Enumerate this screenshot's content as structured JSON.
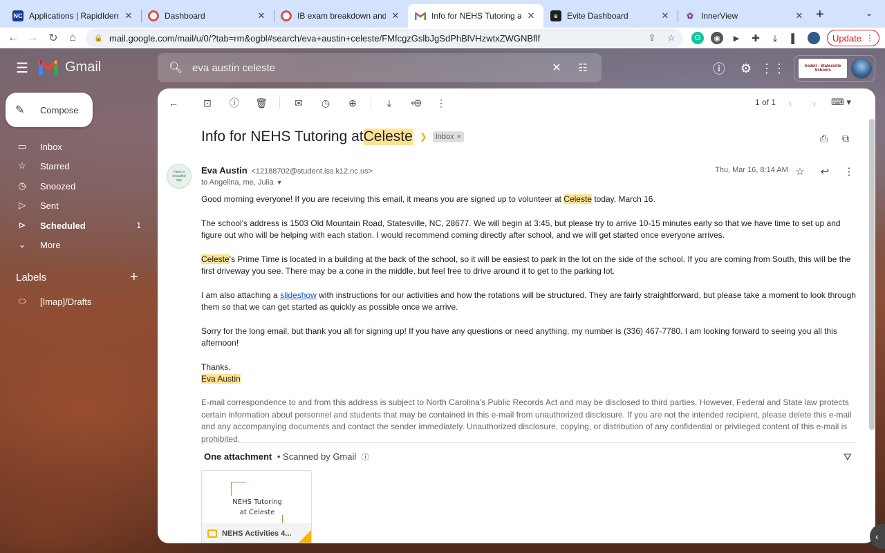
{
  "browser": {
    "tabs": [
      {
        "title": "Applications | RapidIdentity",
        "favicon": "nc-icon"
      },
      {
        "title": "Dashboard",
        "favicon": "lifesaver-icon"
      },
      {
        "title": "IB exam breakdown and stu",
        "favicon": "lifesaver-icon"
      },
      {
        "title": "Info for NEHS Tutoring at C",
        "favicon": "gmail-icon"
      },
      {
        "title": "Evite Dashboard",
        "favicon": "evite-icon"
      },
      {
        "title": "InnerView",
        "favicon": "innerview-icon"
      }
    ],
    "url": "mail.google.com/mail/u/0/?tab=rm&ogbl#search/eva+austin+celeste/FMfcgzGslbJgSdPhBlVHzwtxZWGNBflf",
    "update_label": "Update"
  },
  "gmail": {
    "logo_text": "Gmail",
    "search_value": "eva austin celeste",
    "org_logo_text": "Iredell - Statesville Schools",
    "compose_label": "Compose",
    "nav": [
      {
        "label": "Inbox",
        "icon": "inbox-icon",
        "count": ""
      },
      {
        "label": "Starred",
        "icon": "star-icon",
        "count": ""
      },
      {
        "label": "Snoozed",
        "icon": "clock-icon",
        "count": ""
      },
      {
        "label": "Sent",
        "icon": "send-icon",
        "count": ""
      },
      {
        "label": "Scheduled",
        "icon": "scheduled-icon",
        "count": "1"
      },
      {
        "label": "More",
        "icon": "chevron-down-icon",
        "count": ""
      }
    ],
    "labels_heading": "Labels",
    "labels": [
      {
        "label": "[Imap]/Drafts"
      }
    ],
    "pager": "1 of 1"
  },
  "email": {
    "subject_prefix": "Info for NEHS Tutoring at ",
    "subject_highlight": "Celeste",
    "inbox_chip": "Inbox",
    "sender_name": "Eva Austin",
    "sender_email": "<12188702@student.iss.k12.nc.us>",
    "to_line": "to Angelina, me, Julia",
    "date": "Thu, Mar 16, 8:14 AM",
    "p1_a": "Good morning everyone! If you are receiving this email, it means you are signed up to volunteer at ",
    "p1_hl": "Celeste",
    "p1_b": " today, March 16.",
    "p2": "The school's address is 1503 Old Mountain Road, Statesville, NC, 28677. We will begin at 3:45, but please try to arrive 10-15 minutes early so that we have time to set up and figure out who will be helping with each station. I would recommend coming directly after school, and we will get started once everyone arrives.",
    "p3_hl": "Celeste",
    "p3_b": "'s Prime Time is located in a building at the back of the school, so it will be easiest to park in the lot on the side of the school. If you are coming from South, this will be the first driveway you see. There may be a cone in the middle, but feel free to drive around it to get to the parking lot.",
    "p4_a": "I am also attaching a ",
    "p4_link": "slideshow",
    "p4_b": " with instructions for our activities and how the rotations will be structured. They are fairly straightforward, but please take a moment to look through them so that we can get started as quickly as possible once we arrive.",
    "p5": "Sorry for the long email, but thank you all for signing up! If you have any questions or need anything, my number is (336) 467-7780. I am looking forward to seeing you all this afternoon!",
    "signoff": "Thanks,",
    "signature": "Eva Austin",
    "disclaimer": "E-mail correspondence to and from this address is subject to North Carolina's Public Records Act and may be disclosed to third parties. However, Federal and State law protects certain information about personnel and students that may be contained in this e-mail from unauthorized disclosure. If you are not the intended recipient, please delete this e-mail and any accompanying documents and contact the sender immediately. Unauthorized disclosure, copying, or distribution of any confidential or privileged content of this e-mail is prohibited.",
    "attachment_heading": "One attachment",
    "scanned": "•  Scanned by Gmail",
    "attachment_thumb_line1": "NEHS Tutoring",
    "attachment_thumb_line2": "at Celeste",
    "attachment_name": "NEHS Activities 4..."
  },
  "colors": {
    "highlight": "#fde293",
    "update_red": "#c5221f",
    "link": "#1155cc"
  }
}
